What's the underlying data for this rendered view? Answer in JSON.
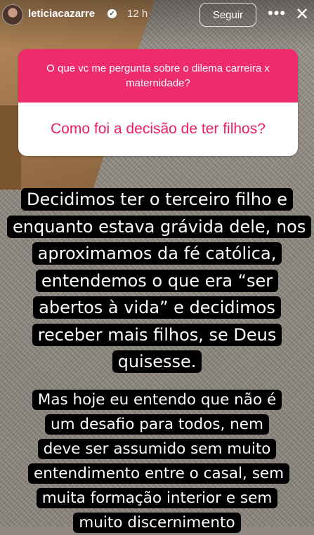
{
  "header": {
    "username": "leticiacazarre",
    "verified_icon": "check",
    "time": "12 h",
    "follow_label": "Seguir",
    "more_icon": "•••",
    "close_icon": "✕"
  },
  "question_box": {
    "prompt": "O que vc me pergunta sobre o dilema carreira x maternidade?",
    "answer": "Como foi a decisão de ter filhos?"
  },
  "captions": {
    "first": "Decidimos ter o terceiro filho e enquanto estava grávida dele, nos aproximamos da fé católica, entendemos o que era “ser abertos à vida” e decidimos receber mais filhos, se Deus quisesse.",
    "second": "Mas hoje eu entendo que não é um desafio para todos, nem deve ser assumido sem muito entendimento entre o casal, sem muita formação interior e sem muito discernimento"
  },
  "colors": {
    "question_pink": "#ef2a6d",
    "answer_text": "#ec1c67"
  }
}
